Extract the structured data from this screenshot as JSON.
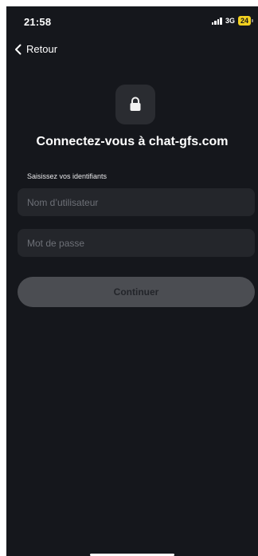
{
  "status_bar": {
    "time": "21:58",
    "network": "3G",
    "battery_level": "24",
    "signal_icon": "signal-bars-icon",
    "battery_color": "#f2d020"
  },
  "nav": {
    "back_label": "Retour",
    "back_icon": "chevron-left-icon"
  },
  "login": {
    "lock_icon": "lock-icon",
    "title": "Connectez-vous à chat-gfs.com",
    "credentials_label": "Saisissez vos identifiants",
    "username_placeholder": "Nom d’utilisateur",
    "username_value": "",
    "password_placeholder": "Mot de passe",
    "password_value": "",
    "continue_label": "Continuer"
  },
  "colors": {
    "background": "#15171c",
    "field_background": "#24262b",
    "button_background": "#4b4d52"
  }
}
